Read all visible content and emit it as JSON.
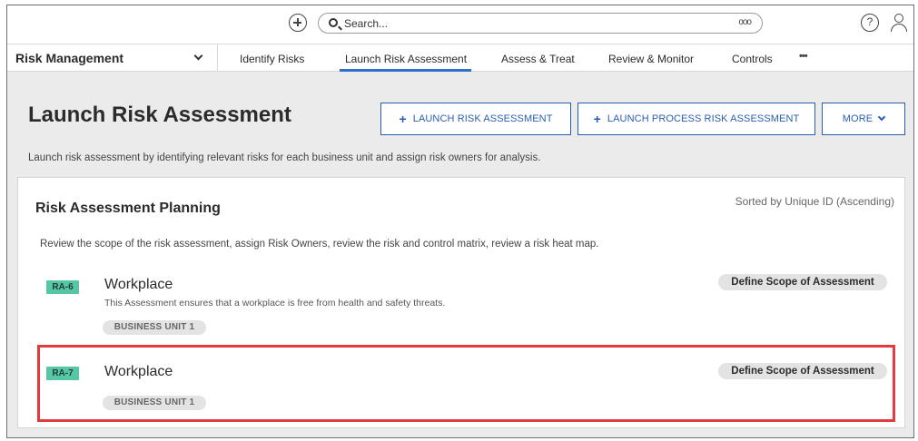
{
  "topbar": {
    "add_icon": "plus-circle-icon",
    "search": {
      "placeholder": "Search..."
    },
    "search_options": "ooo",
    "help_icon_glyph": "?",
    "user_icon": "user-icon"
  },
  "nav": {
    "app_name": "Risk Management",
    "tabs": [
      {
        "label": "Identify Risks",
        "active": false
      },
      {
        "label": "Launch Risk Assessment",
        "active": true
      },
      {
        "label": "Assess & Treat",
        "active": false
      },
      {
        "label": "Review & Monitor",
        "active": false
      },
      {
        "label": "Controls",
        "active": false
      }
    ],
    "more": "•••",
    "active_color": "#2e6fc9"
  },
  "page": {
    "title": "Launch Risk Assessment",
    "buttons": {
      "launch_risk": "LAUNCH RISK ASSESSMENT",
      "launch_process": "LAUNCH PROCESS RISK ASSESSMENT",
      "more": "MORE"
    },
    "button_plus": "+",
    "description": "Launch risk assessment by identifying relevant risks for each business unit and assign risk owners for analysis."
  },
  "card": {
    "title": "Risk Assessment Planning",
    "sort_label": "Sorted by Unique ID (Ascending)",
    "description": "Review the scope of the risk assessment, assign Risk Owners, review the risk and control matrix, review a risk heat map.",
    "items": [
      {
        "id": "RA-6",
        "title": "Workplace",
        "description": "This Assessment ensures that a workplace is free from health and safety threats.",
        "business_unit": "BUSINESS UNIT 1",
        "stage": "Define Scope of Assessment"
      },
      {
        "id": "RA-7",
        "title": "Workplace",
        "description": "",
        "business_unit": "BUSINESS UNIT 1",
        "stage": "Define Scope of Assessment",
        "highlighted": true
      }
    ]
  },
  "colors": {
    "accent": "#2a5db0",
    "id_badge": "#57c6a4",
    "highlight": "#e4393f"
  }
}
